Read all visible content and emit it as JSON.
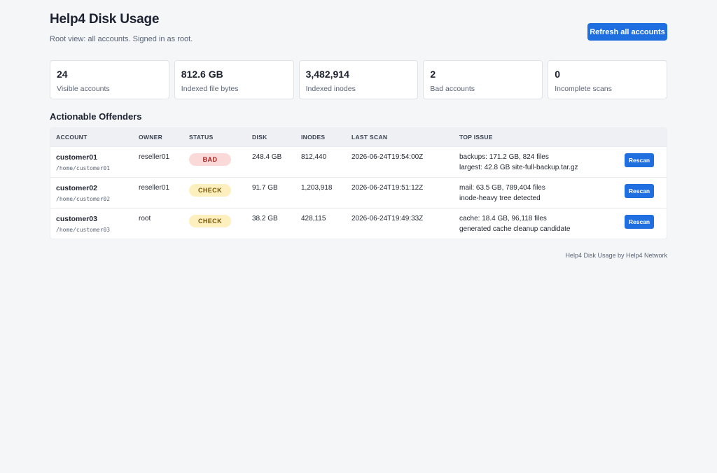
{
  "header": {
    "title": "Help4 Disk Usage",
    "subtitle": "Root view: all accounts. Signed in as root.",
    "refresh_label": "Refresh all accounts"
  },
  "cards": [
    {
      "value": "24",
      "label": "Visible accounts"
    },
    {
      "value": "812.6 GB",
      "label": "Indexed file bytes"
    },
    {
      "value": "3,482,914",
      "label": "Indexed inodes"
    },
    {
      "value": "2",
      "label": "Bad accounts"
    },
    {
      "value": "0",
      "label": "Incomplete scans"
    }
  ],
  "offenders": {
    "title": "Actionable Offenders",
    "columns": [
      "ACCOUNT",
      "OWNER",
      "STATUS",
      "DISK",
      "INODES",
      "LAST SCAN",
      "TOP ISSUE",
      ""
    ],
    "rows": [
      {
        "account": "customer01",
        "path": "/home/customer01",
        "owner": "reseller01",
        "status": "BAD",
        "disk": "248.4 GB",
        "inodes": "812,440",
        "last_scan": "2026-06-24T19:54:00Z",
        "issue_line1": "backups: 171.2 GB, 824 files",
        "issue_line2": "largest: 42.8 GB site-full-backup.tar.gz",
        "action": "Rescan"
      },
      {
        "account": "customer02",
        "path": "/home/customer02",
        "owner": "reseller01",
        "status": "CHECK",
        "disk": "91.7 GB",
        "inodes": "1,203,918",
        "last_scan": "2026-06-24T19:51:12Z",
        "issue_line1": "mail: 63.5 GB, 789,404 files",
        "issue_line2": "inode-heavy tree detected",
        "action": "Rescan"
      },
      {
        "account": "customer03",
        "path": "/home/customer03",
        "owner": "root",
        "status": "CHECK",
        "disk": "38.2 GB",
        "inodes": "428,115",
        "last_scan": "2026-06-24T19:49:33Z",
        "issue_line1": "cache: 18.4 GB, 96,118 files",
        "issue_line2": "generated cache cleanup candidate",
        "action": "Rescan"
      }
    ]
  },
  "footer": {
    "text": "Help4 Disk Usage by Help4 Network"
  },
  "colors": {
    "accent": "#1f6fe0",
    "bad_bg": "#fbd9d9",
    "bad_text": "#a32020",
    "check_bg": "#fdefbe",
    "check_text": "#7a5400"
  }
}
